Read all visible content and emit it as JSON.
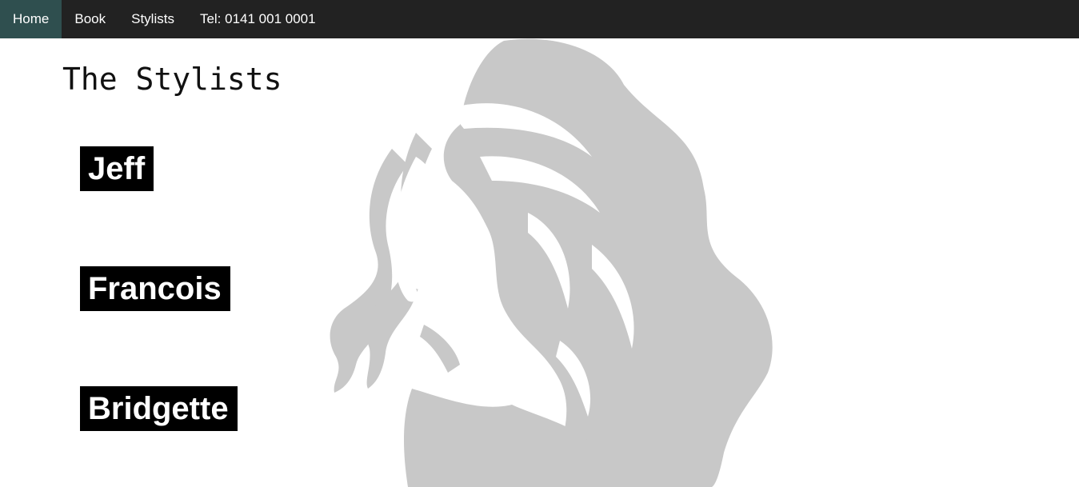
{
  "nav": {
    "items": [
      {
        "label": "Home",
        "active": true
      },
      {
        "label": "Book",
        "active": false
      },
      {
        "label": "Stylists",
        "active": false
      },
      {
        "label": "Tel: 0141 001 0001",
        "active": false
      }
    ]
  },
  "main": {
    "title": "The Stylists",
    "stylists": [
      {
        "name": "Jeff"
      },
      {
        "name": "Francois"
      },
      {
        "name": "Bridgette"
      }
    ]
  },
  "decor": {
    "illustration": "woman-hair-silhouette",
    "illustration_color": "#c8c8c8"
  },
  "colors": {
    "navbar_bg": "#222222",
    "nav_active_bg": "#2f4f4f",
    "nav_text": "#ffffff",
    "name_tag_bg": "#000000",
    "name_tag_text": "#ffffff"
  }
}
